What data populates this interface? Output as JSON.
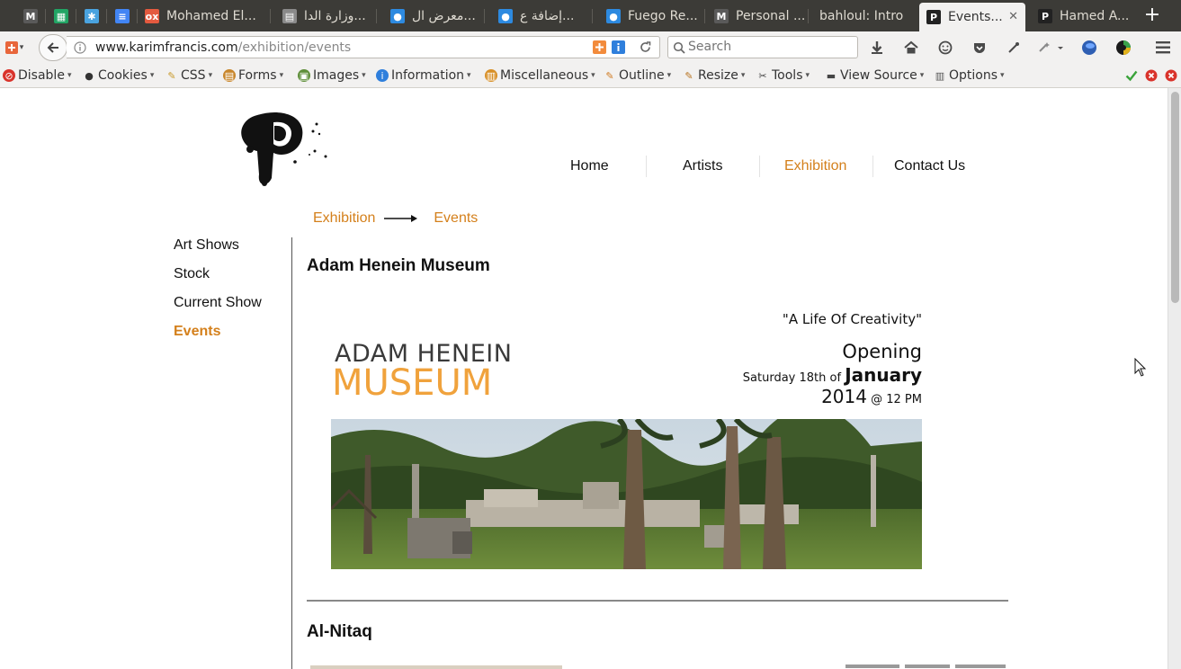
{
  "browser": {
    "tabs": [
      {
        "label": "",
        "favicon": "gmail-icon",
        "fav_glyph": "M",
        "fav_color": "#5a5a5a"
      },
      {
        "label": "",
        "favicon": "sheets-icon",
        "fav_glyph": "▦",
        "fav_color": "#22a565"
      },
      {
        "label": "",
        "favicon": "asterisk-app-icon",
        "fav_glyph": "✱",
        "fav_color": "#4aa3df"
      },
      {
        "label": "",
        "favicon": "docs-icon",
        "fav_glyph": "≡",
        "fav_color": "#4285f4"
      },
      {
        "label": "Mohamed El...",
        "favicon": "odoo-icon",
        "fav_glyph": "ox",
        "fav_color": "#e45a3f"
      },
      {
        "label": "وزارة الدا...",
        "favicon": "document-icon",
        "fav_glyph": "▤",
        "fav_color": "#8a8a8a"
      },
      {
        "label": "معرض ال...",
        "favicon": "circle-app-icon",
        "fav_glyph": "●",
        "fav_color": "#2d8ae0"
      },
      {
        "label": "إضافة ع...",
        "favicon": "circle-app-icon",
        "fav_glyph": "●",
        "fav_color": "#2d8ae0"
      },
      {
        "label": "Fuego Re...",
        "favicon": "circle-app-icon",
        "fav_glyph": "●",
        "fav_color": "#2d8ae0"
      },
      {
        "label": "Personal ...",
        "favicon": "gmail-icon",
        "fav_glyph": "M",
        "fav_color": "#5a5a5a"
      },
      {
        "label": "bahloul: Intro",
        "favicon": "",
        "fav_glyph": "",
        "fav_color": "#3c3b37"
      },
      {
        "label": "Events...",
        "favicon": "site-p-icon",
        "fav_glyph": "P",
        "fav_color": "#222"
      },
      {
        "label": "Hamed A...",
        "favicon": "site-p-icon",
        "fav_glyph": "P",
        "fav_color": "#222"
      }
    ],
    "url_host": "www.karimfrancis.com",
    "url_path": "/exhibition/events",
    "search_placeholder": "Search"
  },
  "webdev_toolbar": {
    "items": [
      {
        "label": "Disable",
        "icon": "disable-icon"
      },
      {
        "label": "Cookies",
        "icon": "cookies-icon"
      },
      {
        "label": "CSS",
        "icon": "css-wand-icon"
      },
      {
        "label": "Forms",
        "icon": "forms-icon"
      },
      {
        "label": "Images",
        "icon": "images-icon"
      },
      {
        "label": "Information",
        "icon": "information-icon"
      },
      {
        "label": "Miscellaneous",
        "icon": "miscellaneous-icon"
      },
      {
        "label": "Outline",
        "icon": "outline-pencil-icon"
      },
      {
        "label": "Resize",
        "icon": "resize-ruler-icon"
      },
      {
        "label": "Tools",
        "icon": "tools-icon"
      },
      {
        "label": "View Source",
        "icon": "view-source-icon"
      },
      {
        "label": "Options",
        "icon": "options-icon"
      }
    ]
  },
  "site": {
    "nav": [
      {
        "label": "Home",
        "active": false
      },
      {
        "label": "Artists",
        "active": false
      },
      {
        "label": "Exhibition",
        "active": true
      },
      {
        "label": "Contact Us",
        "active": false
      }
    ],
    "breadcrumb": {
      "parent": "Exhibition",
      "current": "Events"
    },
    "sidebar": [
      {
        "label": "Art Shows",
        "active": false
      },
      {
        "label": "Stock",
        "active": false
      },
      {
        "label": "Current Show",
        "active": false
      },
      {
        "label": "Events",
        "active": true
      }
    ],
    "events": [
      {
        "title": "Adam Henein Museum",
        "poster": {
          "quote": "\"A Life Of Creativity\"",
          "brand_line1": "ADAM HENEIN",
          "brand_line2": "MUSEUM",
          "opening": "Opening",
          "date_prefix": "Saturday 18th of",
          "month": "January",
          "year": "2014",
          "time": "@ 12 PM"
        }
      },
      {
        "title": "Al-Nitaq"
      }
    ]
  },
  "colors": {
    "accent": "#d4801c",
    "brand_orange": "#f0a23c",
    "tab_strip": "#3c3b37"
  }
}
